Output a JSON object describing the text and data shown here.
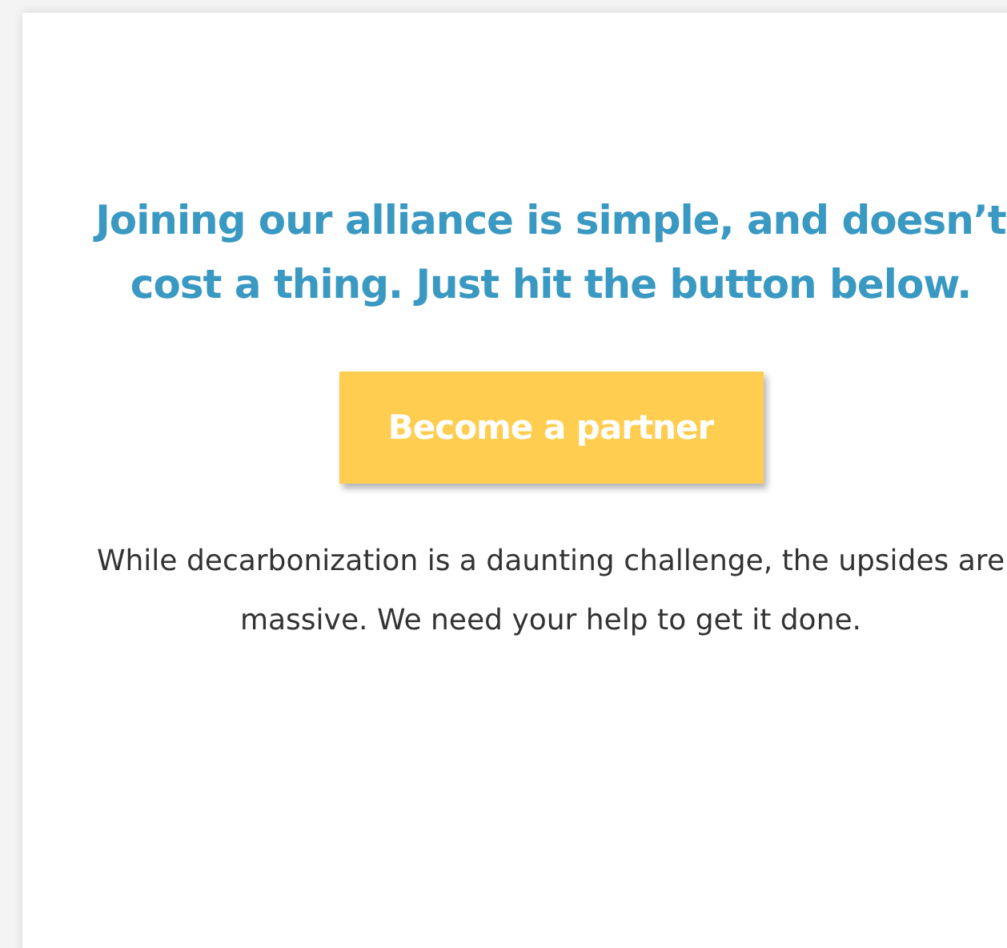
{
  "heading": "Joining our alliance is simple, and doesn’t cost a thing. Just hit the button below.",
  "button": {
    "label": "Become a partner"
  },
  "body": "While decarbonization is a daunting challenge, the upsides are massive. We need your help to get it done."
}
